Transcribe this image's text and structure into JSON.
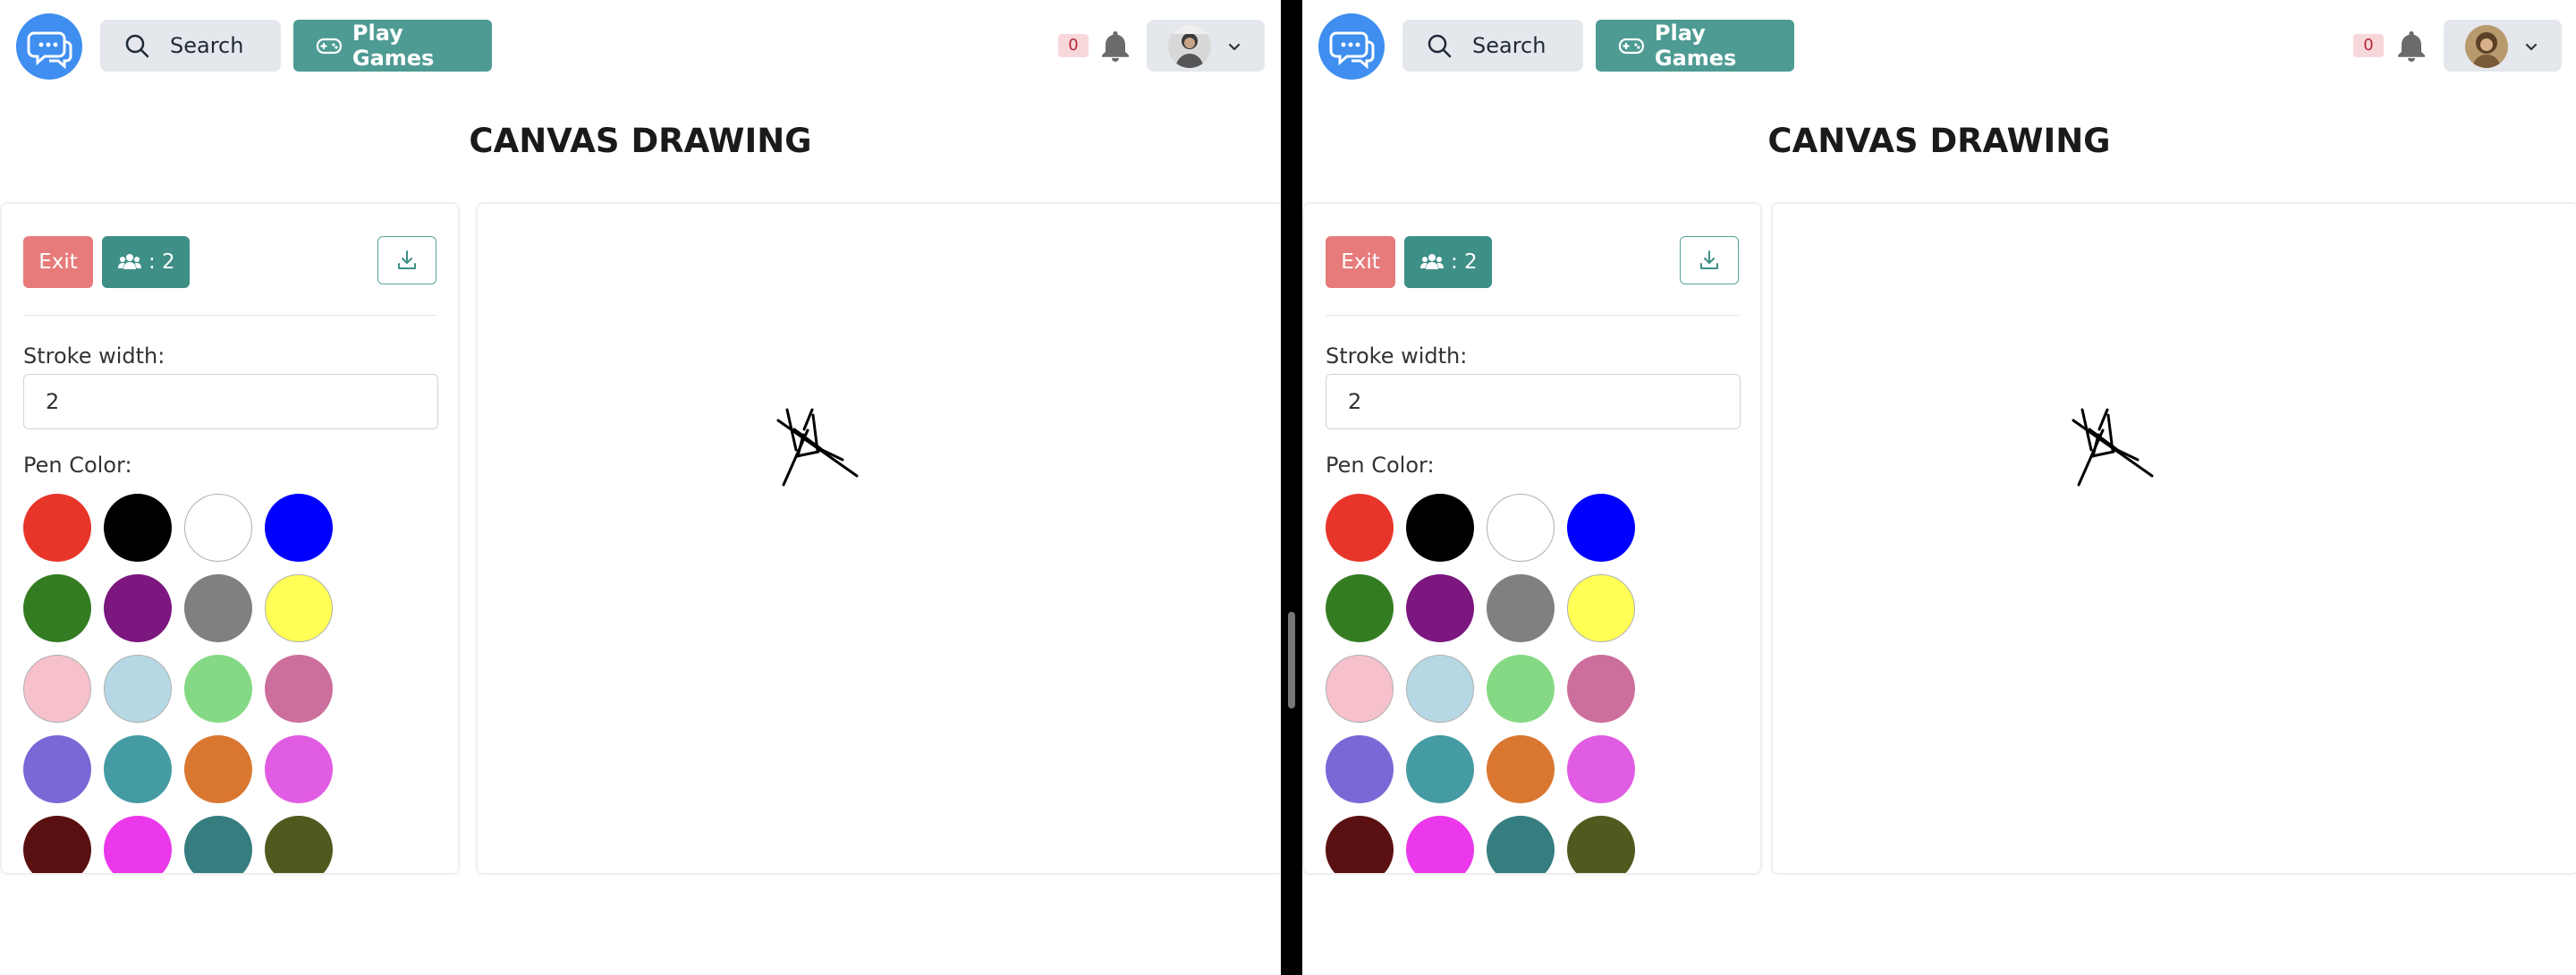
{
  "panes": [
    {
      "id": "left",
      "nav": {
        "search_label": "Search",
        "play_games_label": "Play Games",
        "notification_count": "0"
      },
      "page_title": "CANVAS DRAWING",
      "tools": {
        "exit_label": "Exit",
        "participants_label": ": 2",
        "stroke_width_label": "Stroke width:",
        "stroke_width_value": "2",
        "pen_color_label": "Pen Color:"
      }
    },
    {
      "id": "right",
      "nav": {
        "search_label": "Search",
        "play_games_label": "Play Games",
        "notification_count": "0"
      },
      "page_title": "CANVAS DRAWING",
      "tools": {
        "exit_label": "Exit",
        "participants_label": ": 2",
        "stroke_width_label": "Stroke width:",
        "stroke_width_value": "2",
        "pen_color_label": "Pen Color:"
      }
    }
  ],
  "pen_colors": [
    "#e8352a",
    "#000000",
    "#ffffff",
    "#0000ff",
    "#347c22",
    "#7b177f",
    "#808080",
    "#ffff55",
    "#f6c1cb",
    "#b6d8e4",
    "#86d984",
    "#cc6f9d",
    "#7a68d6",
    "#459ba3",
    "#d97731",
    "#e05ce2",
    "#5a1010",
    "#ea38ea",
    "#357d7f",
    "#4f5a1f"
  ],
  "icons": {
    "logo": "chat-bubbles-icon",
    "search": "search-icon",
    "play": "gamepad-icon",
    "bell": "bell-icon",
    "participants": "users-icon",
    "download": "download-icon",
    "dropdown": "chevron-down-icon"
  },
  "colors": {
    "logo_blue": "#3f8ef0",
    "teal": "#4e9b94",
    "exit_red": "#e77b7b"
  }
}
